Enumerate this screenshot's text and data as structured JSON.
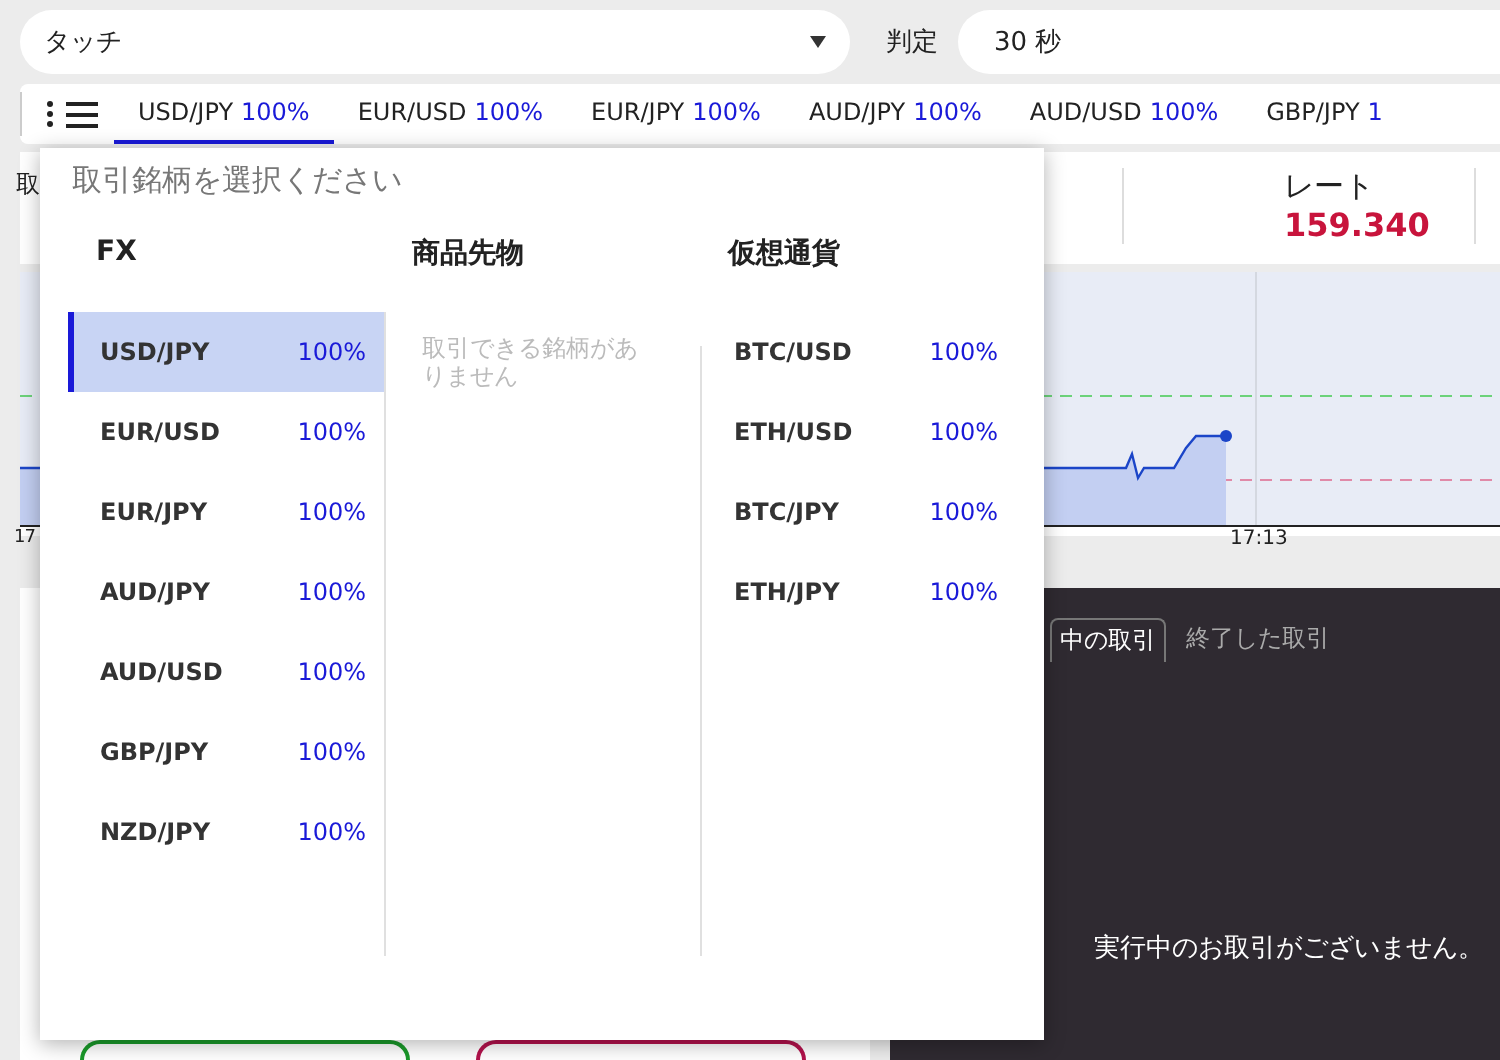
{
  "mode_select": {
    "value": "タッチ"
  },
  "judgement": {
    "label": "判定",
    "value": "30 秒"
  },
  "symbol_tabs": [
    {
      "symbol": "USD/JPY",
      "payout": "100%",
      "selected": true
    },
    {
      "symbol": "EUR/USD",
      "payout": "100%",
      "selected": false
    },
    {
      "symbol": "EUR/JPY",
      "payout": "100%",
      "selected": false
    },
    {
      "symbol": "AUD/JPY",
      "payout": "100%",
      "selected": false
    },
    {
      "symbol": "AUD/USD",
      "payout": "100%",
      "selected": false
    },
    {
      "symbol": "GBP/JPY",
      "payout": "1",
      "selected": false
    }
  ],
  "trade_header": {
    "title_cut": "取",
    "rate_label": "レート",
    "rate_value": "159.340"
  },
  "chart": {
    "time_labels": [
      "17",
      "17:13"
    ]
  },
  "trades_panel": {
    "tabs": [
      {
        "label": "中の取引",
        "selected": true
      },
      {
        "label": "終了した取引",
        "selected": false
      }
    ],
    "empty_message": "実行中のお取引がございません。"
  },
  "order_buttons": [
    {
      "color": "#1a9a2a"
    },
    {
      "color": "#b3124c"
    }
  ],
  "symbol_picker": {
    "title": "取引銘柄を選択ください",
    "columns": [
      {
        "heading": "FX",
        "items": [
          {
            "symbol": "USD/JPY",
            "payout": "100%",
            "selected": true
          },
          {
            "symbol": "EUR/USD",
            "payout": "100%",
            "selected": false
          },
          {
            "symbol": "EUR/JPY",
            "payout": "100%",
            "selected": false
          },
          {
            "symbol": "AUD/JPY",
            "payout": "100%",
            "selected": false
          },
          {
            "symbol": "AUD/USD",
            "payout": "100%",
            "selected": false
          },
          {
            "symbol": "GBP/JPY",
            "payout": "100%",
            "selected": false
          },
          {
            "symbol": "NZD/JPY",
            "payout": "100%",
            "selected": false
          }
        ]
      },
      {
        "heading": "商品先物",
        "empty_message": "取引できる銘柄がありません"
      },
      {
        "heading": "仮想通貨",
        "items": [
          {
            "symbol": "BTC/USD",
            "payout": "100%",
            "selected": false
          },
          {
            "symbol": "ETH/USD",
            "payout": "100%",
            "selected": false
          },
          {
            "symbol": "BTC/JPY",
            "payout": "100%",
            "selected": false
          },
          {
            "symbol": "ETH/JPY",
            "payout": "100%",
            "selected": false
          }
        ]
      }
    ]
  }
}
